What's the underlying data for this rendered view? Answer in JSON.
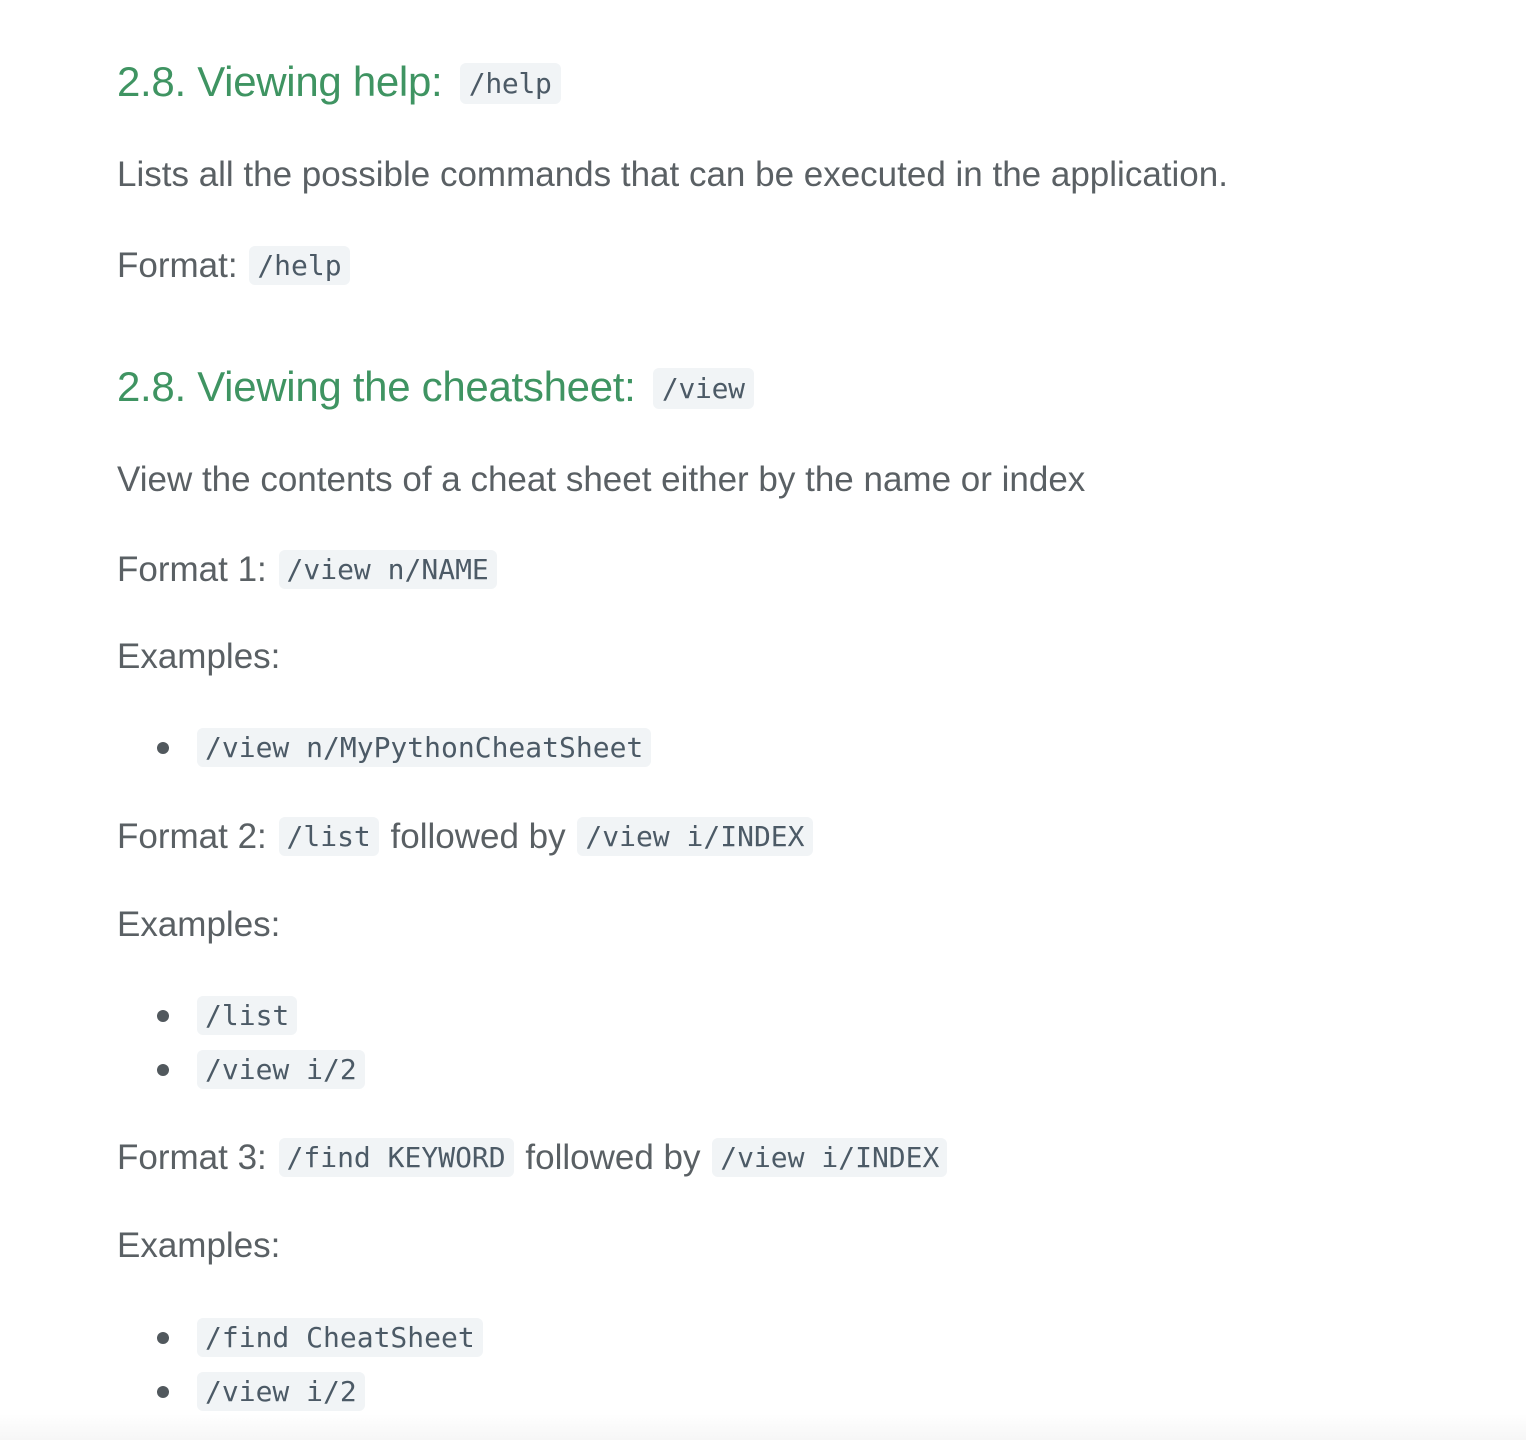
{
  "section_help": {
    "heading": "2.8. Viewing help:",
    "heading_code": "/help",
    "description": "Lists all the possible commands that can be executed in the application.",
    "format_label": "Format:",
    "format_code": "/help"
  },
  "section_view": {
    "heading": "2.8. Viewing the cheatsheet:",
    "heading_code": "/view",
    "description": "View the contents of a cheat sheet either by the name or index",
    "format1_label": "Format 1:",
    "format1_code": "/view n/NAME",
    "examples1_label": "Examples:",
    "examples1": [
      "/view n/MyPythonCheatSheet"
    ],
    "format2_label": "Format 2:",
    "format2_code_a": "/list",
    "format2_mid": "followed by",
    "format2_code_b": "/view i/INDEX",
    "examples2_label": "Examples:",
    "examples2": [
      "/list",
      "/view i/2"
    ],
    "format3_label": "Format 3:",
    "format3_code_a": "/find KEYWORD",
    "format3_mid": "followed by",
    "format3_code_b": "/view i/INDEX",
    "examples3_label": "Examples:",
    "examples3": [
      "/find CheatSheet",
      "/view i/2"
    ]
  },
  "colors": {
    "heading": "#3f9462",
    "text": "#5a6064",
    "code_bg": "#f1f4f6",
    "code_text": "#4c5a66"
  }
}
